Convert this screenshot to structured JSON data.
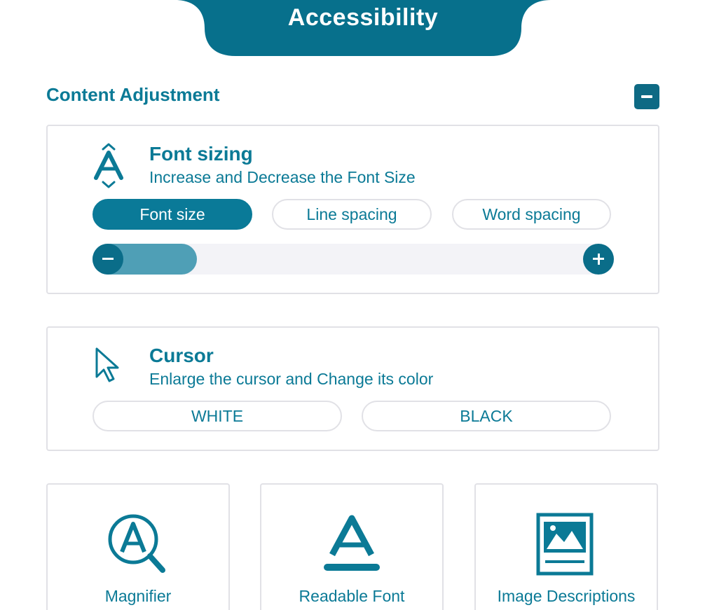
{
  "header": {
    "title": "Accessibility"
  },
  "section": {
    "title": "Content Adjustment",
    "collapse_icon": "minus-icon"
  },
  "font_sizing": {
    "icon": "font-size-icon",
    "title": "Font sizing",
    "description": "Increase and Decrease the Font Size",
    "tabs": [
      {
        "label": "Font size",
        "active": true
      },
      {
        "label": "Line spacing",
        "active": false
      },
      {
        "label": "Word spacing",
        "active": false
      }
    ],
    "slider": {
      "level": 0.1
    }
  },
  "cursor": {
    "icon": "cursor-icon",
    "title": "Cursor",
    "description": "Enlarge the cursor and Change its color",
    "options": [
      {
        "label": "WHITE"
      },
      {
        "label": "BLACK"
      }
    ]
  },
  "tools": [
    {
      "label": "Magnifier",
      "icon": "magnifier-icon"
    },
    {
      "label": "Readable Font",
      "icon": "readable-font-icon"
    },
    {
      "label": "Image Descriptions",
      "icon": "image-descriptions-icon"
    }
  ],
  "colors": {
    "primary": "#0a7a98",
    "dark": "#0e6a84",
    "border": "#e1e1e6"
  }
}
